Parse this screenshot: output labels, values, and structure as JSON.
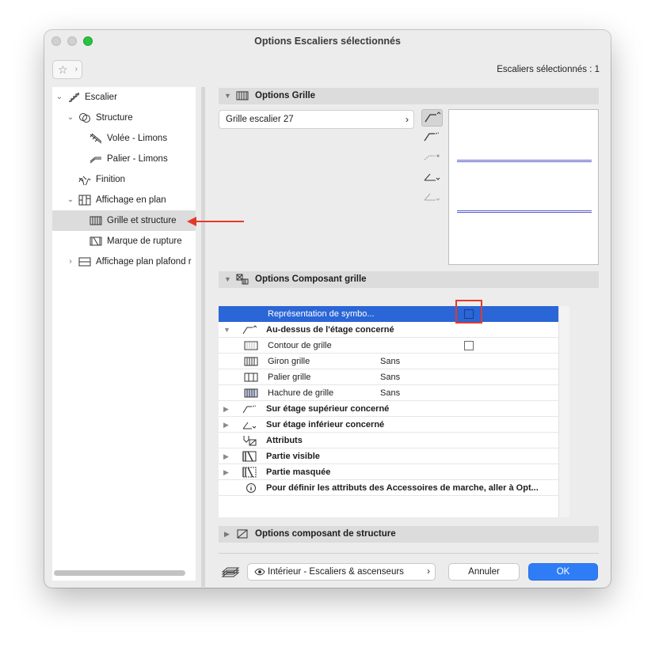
{
  "window": {
    "title": "Options Escaliers sélectionnés",
    "selection_info": "Escaliers sélectionnés : 1",
    "favorites_icon": "star-icon"
  },
  "tree": {
    "items": [
      {
        "label": "Escalier",
        "icon": "stair-icon",
        "twisty": "⌄"
      },
      {
        "label": "Structure",
        "icon": "structure-icon",
        "twisty": "⌄"
      },
      {
        "label": "Volée - Limons",
        "icon": "flight-icon"
      },
      {
        "label": "Palier - Limons",
        "icon": "landing-icon"
      },
      {
        "label": "Finition",
        "icon": "finish-icon"
      },
      {
        "label": "Affichage en plan",
        "icon": "floorplan-icon",
        "twisty": "⌄"
      },
      {
        "label": "Grille et structure",
        "icon": "grid-icon",
        "selected": true
      },
      {
        "label": "Marque de rupture",
        "icon": "break-mark-icon"
      },
      {
        "label": "Affichage plan plafond r",
        "icon": "ceiling-plan-icon",
        "twisty": "›"
      }
    ]
  },
  "grid_options": {
    "title": "Options Grille",
    "preset": "Grille escalier 27",
    "chevron": "›"
  },
  "component_options": {
    "title": "Options Composant grille",
    "rows": [
      {
        "label": "Représentation de symbo...",
        "value": "",
        "checkbox": true,
        "highlight": true
      },
      {
        "label": "Au-dessus de l'étage concerné",
        "value": "",
        "expanded": true,
        "bold": true
      },
      {
        "label": "Contour de grille",
        "value": "",
        "checkbox": true
      },
      {
        "label": "Giron grille",
        "value": "Sans"
      },
      {
        "label": "Palier grille",
        "value": "Sans"
      },
      {
        "label": "Hachure de grille",
        "value": "Sans"
      },
      {
        "label": "Sur étage supérieur concerné",
        "value": "",
        "bold": true
      },
      {
        "label": "Sur étage inférieur concerné",
        "value": "",
        "bold": true
      },
      {
        "label": "Attributs",
        "value": "",
        "bold": true
      },
      {
        "label": "Partie visible",
        "value": "",
        "bold": true
      },
      {
        "label": "Partie masquée",
        "value": "",
        "bold": true
      },
      {
        "label": "Pour définir les attributs des Accessoires de marche, aller à Opt...",
        "value": "",
        "bold": true
      }
    ]
  },
  "structure_options": {
    "title": "Options composant de structure"
  },
  "footer": {
    "layer_select": "Intérieur - Escaliers & ascenseurs",
    "cancel": "Annuler",
    "ok": "OK"
  },
  "colors": {
    "highlight": "#2b66d6",
    "primary_button": "#2f7df6",
    "annotation_red": "#e23a2a",
    "preview_line": "#5b5ec8"
  }
}
